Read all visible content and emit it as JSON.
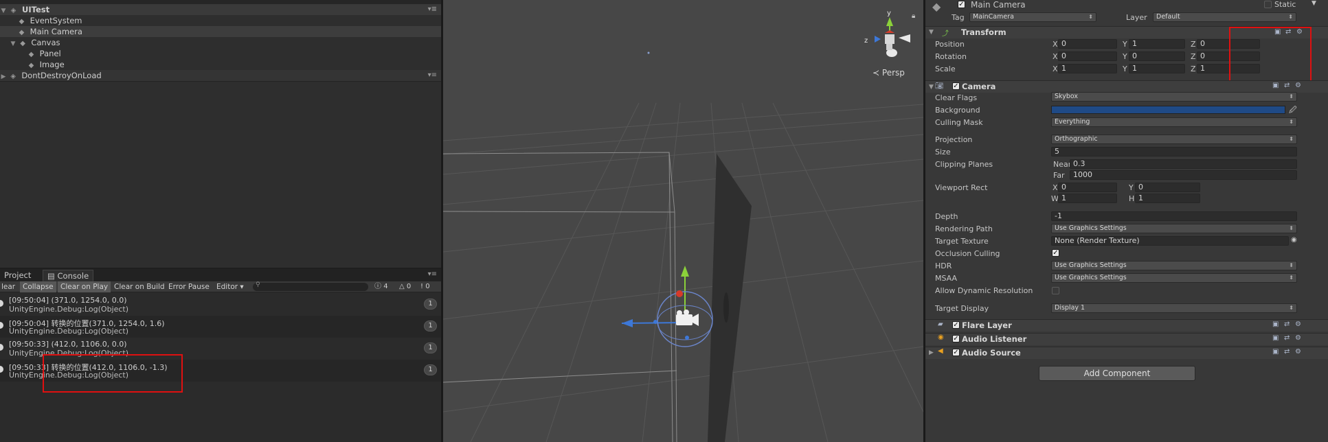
{
  "hierarchy": {
    "scene": "UITest",
    "items": [
      "EventSystem",
      "Main Camera",
      "Canvas",
      "Panel",
      "Image"
    ],
    "dont_destroy": "DontDestroyOnLoad"
  },
  "console": {
    "tabs": [
      "Project",
      "Console"
    ],
    "toolbar": {
      "clear": "lear",
      "collapse": "Collapse",
      "clear_on_play": "Clear on Play",
      "clear_on_build": "Clear on Build",
      "error_pause": "Error Pause",
      "editor": "Editor ▾",
      "count_info": "4",
      "count_warn": "0",
      "count_error": "0"
    },
    "logs": [
      {
        "line1": "[09:50:04] (371.0, 1254.0, 0.0)",
        "line2": "UnityEngine.Debug:Log(Object)",
        "count": "1"
      },
      {
        "line1": "[09:50:04] 转换的位置(371.0, 1254.0, 1.6)",
        "line2": "UnityEngine.Debug:Log(Object)",
        "count": "1"
      },
      {
        "line1": "[09:50:33] (412.0, 1106.0, 0.0)",
        "line2": "UnityEngine.Debug:Log(Object)",
        "count": "1"
      },
      {
        "line1": "[09:50:33] 转换的位置(412.0, 1106.0, -1.3)",
        "line2": "UnityEngine.Debug:Log(Object)",
        "count": "1"
      }
    ]
  },
  "scene": {
    "persp_label": "Persp",
    "gizmo_y": "y",
    "gizmo_z": "z"
  },
  "inspector": {
    "object_name": "Main Camera",
    "static_label": "Static",
    "tag_label": "Tag",
    "tag_value": "MainCamera",
    "layer_label": "Layer",
    "layer_value": "Default",
    "transform": {
      "title": "Transform",
      "position_label": "Position",
      "position": {
        "x": "0",
        "y": "1",
        "z": "0"
      },
      "rotation_label": "Rotation",
      "rotation": {
        "x": "0",
        "y": "0",
        "z": "0"
      },
      "scale_label": "Scale",
      "scale": {
        "x": "1",
        "y": "1",
        "z": "1"
      }
    },
    "camera": {
      "title": "Camera",
      "clear_flags_label": "Clear Flags",
      "clear_flags": "Skybox",
      "background_label": "Background",
      "background_color": "#1f4a86",
      "culling_mask_label": "Culling Mask",
      "culling_mask": "Everything",
      "projection_label": "Projection",
      "projection": "Orthographic",
      "size_label": "Size",
      "size": "5",
      "clipping_label": "Clipping Planes",
      "near_label": "Near",
      "near": "0.3",
      "far_label": "Far",
      "far": "1000",
      "viewport_label": "Viewport Rect",
      "vx_label": "X",
      "vx": "0",
      "vy_label": "Y",
      "vy": "0",
      "vw_label": "W",
      "vw": "1",
      "vh_label": "H",
      "vh": "1",
      "depth_label": "Depth",
      "depth": "-1",
      "rendering_path_label": "Rendering Path",
      "rendering_path": "Use Graphics Settings",
      "target_texture_label": "Target Texture",
      "target_texture": "None (Render Texture)",
      "occlusion_label": "Occlusion Culling",
      "hdr_label": "HDR",
      "hdr": "Use Graphics Settings",
      "msaa_label": "MSAA",
      "msaa": "Use Graphics Settings",
      "dynamic_res_label": "Allow Dynamic Resolution",
      "target_display_label": "Target Display",
      "target_display": "Display 1"
    },
    "components": [
      "Flare Layer",
      "Audio Listener",
      "Audio Source"
    ],
    "add_component": "Add Component"
  }
}
